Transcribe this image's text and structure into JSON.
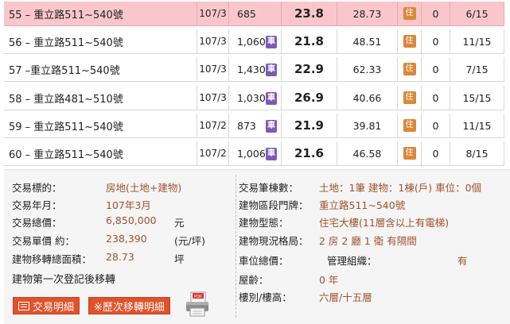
{
  "rows": [
    {
      "address": "55 – 重立路511~540號",
      "date": "107/3",
      "price": "685",
      "unit_price": "23.8",
      "area": "28.73",
      "type_icon": "住",
      "parking": "0",
      "floor": "6/15",
      "has_car": false,
      "selected": true
    },
    {
      "address": "56 – 重立路511~540號",
      "date": "107/3",
      "price": "1,060",
      "unit_price": "21.8",
      "area": "48.51",
      "type_icon": "住",
      "parking": "0",
      "floor": "11/15",
      "has_car": true,
      "selected": false
    },
    {
      "address": "57 –重立路511~540號",
      "date": "107/3",
      "price": "1,430",
      "unit_price": "22.9",
      "area": "62.33",
      "type_icon": "住",
      "parking": "0",
      "floor": "7/15",
      "has_car": true,
      "selected": false
    },
    {
      "address": "58 – 重立路481~510號",
      "date": "107/3",
      "price": "1,030",
      "unit_price": "26.9",
      "area": "40.66",
      "type_icon": "住",
      "parking": "0",
      "floor": "15/15",
      "has_car": true,
      "selected": false
    },
    {
      "address": "59 – 重立路511~540號",
      "date": "107/2",
      "price": "873",
      "unit_price": "21.9",
      "area": "39.81",
      "type_icon": "住",
      "parking": "0",
      "floor": "11/15",
      "has_car": true,
      "selected": false
    },
    {
      "address": "60 – 重立路511~540號",
      "date": "107/2",
      "price": "1,006",
      "unit_price": "21.6",
      "area": "46.58",
      "type_icon": "住",
      "parking": "0",
      "floor": "8/15",
      "has_car": true,
      "selected": false
    }
  ],
  "car_icon_label": "車",
  "detail": {
    "left": {
      "target_label": "交易標的：",
      "target_value": "房地(土地+建物)",
      "ym_label": "交易年月：",
      "ym_value": "107年3月",
      "total_label": "交易總價：",
      "total_value": "6,850,000",
      "total_unit": "元",
      "unit_label": "交易單價 約：",
      "unit_value": "238,390",
      "unit_unit": "(元/坪)",
      "area_label": "建物移轉總面積：",
      "area_value": "28.73",
      "area_unit": "坪",
      "note": "建物第一次登記後移轉"
    },
    "right": {
      "count_label": "交易筆棟數：",
      "count_value": "土地：1筆 建物：1棟(戶) 車位：0個",
      "door_label": "建物區段門牌：",
      "door_value": "重立路511~540號",
      "btype_label": "建物型態：",
      "btype_value": "住宅大樓(11層含以上有電梯)",
      "layout_label": "建物現況格局：",
      "layout_value": "2 房 2 廳 1 衛 有隔間",
      "parking_label": "車位總價：",
      "mgmt_label": "管理組織：",
      "mgmt_value": "有",
      "age_label": "屋齡：",
      "age_value": "0  年",
      "floor_label": "樓別/樓高：",
      "floor_value": "六層/十五層"
    }
  },
  "buttons": {
    "detail_label": "交易明細",
    "history_label": "※歷次移轉明細",
    "pdf_label": "PDF"
  },
  "colors": {
    "selected_row": "#f9c7cb",
    "car_icon": "#7a5bb5",
    "residential_icon": "#d9893a",
    "value_text": "#a0522d",
    "button": "#e0522b"
  }
}
